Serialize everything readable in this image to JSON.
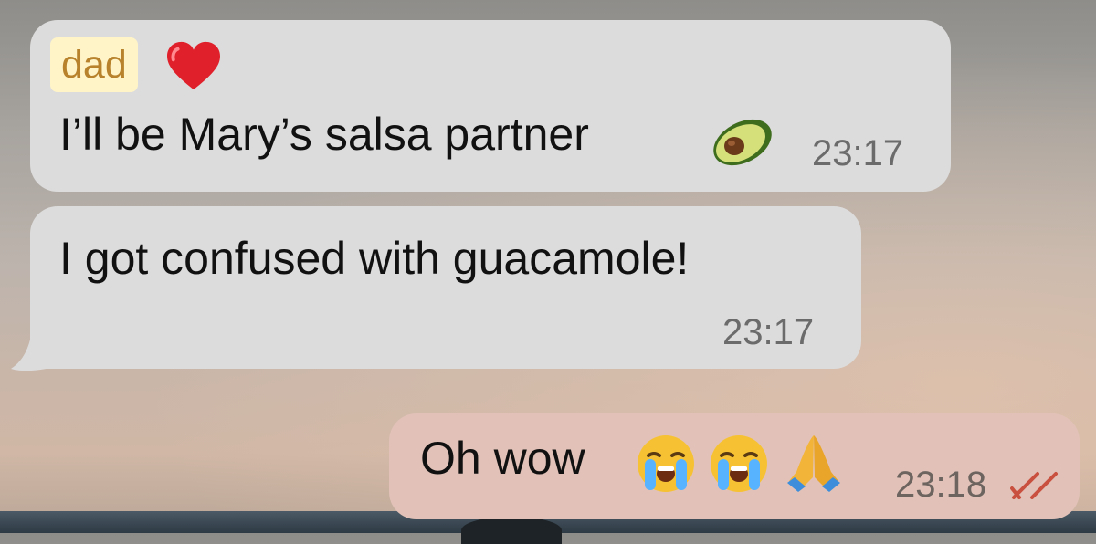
{
  "messages": [
    {
      "sender": "dad",
      "sender_heart": "red-heart-emoji",
      "text": "I’ll be Mary’s salsa partner",
      "trailing_emoji": "avocado-emoji",
      "time": "23:17",
      "direction": "incoming"
    },
    {
      "text": "I got confused with guacamole!",
      "time": "23:17",
      "direction": "incoming"
    },
    {
      "text": "Oh wow",
      "emojis": [
        "loudly-crying-face-emoji",
        "loudly-crying-face-emoji",
        "folded-hands-emoji"
      ],
      "time": "23:18",
      "status": "read",
      "status_icon": "double-check-icon",
      "direction": "outgoing"
    }
  ],
  "colors": {
    "incoming_bubble": "#dcdcdc",
    "outgoing_bubble": "#e2c2b8",
    "sender_name": "#b7822b",
    "sender_highlight": "#fff4c8",
    "read_ticks": "#c9503f"
  }
}
